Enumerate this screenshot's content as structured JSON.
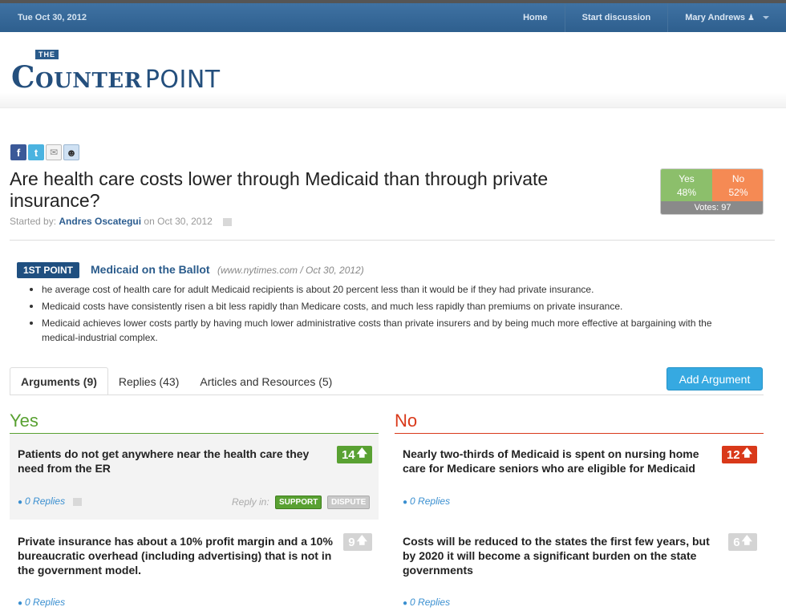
{
  "topbar": {
    "date": "Tue Oct 30, 2012",
    "nav": [
      "Home",
      "Start discussion",
      "Mary Andrews"
    ]
  },
  "logo": {
    "the": "THE",
    "counter": "Counter",
    "point": "POINT"
  },
  "share_icons": [
    "facebook-icon",
    "twitter-icon",
    "email-icon",
    "reddit-icon"
  ],
  "question": {
    "title": "Are health care costs lower through Medicaid than through private insurance?",
    "started_by_label": "Started by:",
    "author": "Andres Oscategui",
    "date_text": "on Oct 30, 2012"
  },
  "votes": {
    "yes_label": "Yes",
    "yes_pct": "48%",
    "no_label": "No",
    "no_pct": "52%",
    "total": "Votes: 97",
    "colors": {
      "yes": "#8cbf6b",
      "no": "#f58a54"
    }
  },
  "first_point": {
    "badge": "1ST POINT",
    "title": "Medicaid on the Ballot",
    "source": "(www.nytimes.com / Oct 30, 2012)",
    "bullets": [
      "he average cost of health care for adult Medicaid recipients is about 20 percent less than it would be if they had private insurance.",
      "Medicaid costs have consistently risen a bit less rapidly than Medicare costs, and much less rapidly than premiums on private insurance.",
      "Medicaid achieves lower costs partly by having much lower administrative costs than private insurers and by being much more effective at bargaining with the medical-industrial complex."
    ]
  },
  "tabs": [
    "Arguments (9)",
    "Replies (43)",
    "Articles and Resources (5)"
  ],
  "add_argument": "Add Argument",
  "columns": {
    "yes": {
      "heading": "Yes",
      "cards": [
        {
          "text": "Patients do not get anywhere near the health care they need from the ER",
          "score": "14",
          "replies": "0 Replies",
          "reply_in": "Reply in:",
          "support": "SUPPORT",
          "dispute": "DISPUTE"
        },
        {
          "text": "Private insurance has about a 10% profit margin and a 10% bureaucratic overhead (including advertising) that is not in the government model.",
          "score": "9",
          "replies": "0 Replies"
        }
      ]
    },
    "no": {
      "heading": "No",
      "cards": [
        {
          "text": "Nearly two-thirds of Medicaid is spent on nursing home care for Medicare seniors who are eligible for Medicaid",
          "score": "12",
          "replies": "0 Replies"
        },
        {
          "text": "Costs will be reduced to the states the first few years, but by 2020 it will become a significant burden on the state governments",
          "score": "6",
          "replies": "0 Replies"
        }
      ]
    }
  },
  "colors": {
    "brand": "#2a5b8b",
    "yes": "#59a132",
    "no": "#d9391a",
    "button": "#36a9e1"
  }
}
